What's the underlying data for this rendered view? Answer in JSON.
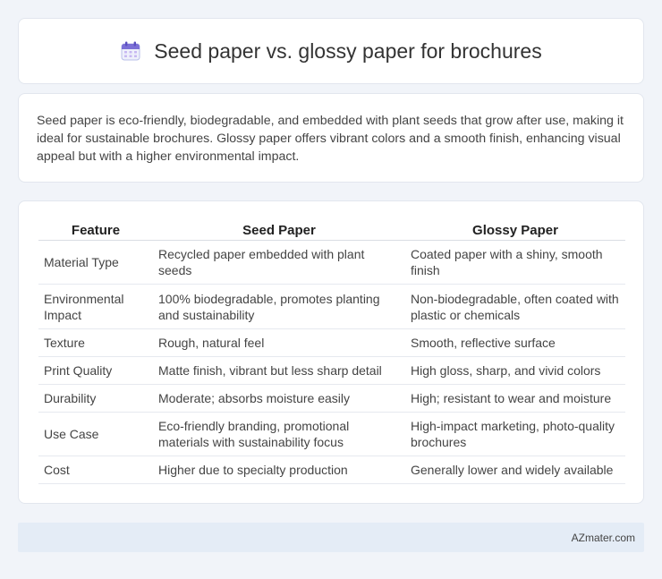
{
  "page": {
    "title": "Seed paper vs. glossy paper for brochures",
    "intro": "Seed paper is eco-friendly, biodegradable, and embedded with plant seeds that grow after use, making it ideal for sustainable brochures. Glossy paper offers vibrant colors and a smooth finish, enhancing visual appeal but with a higher environmental impact.",
    "icon": "calendar-icon"
  },
  "table": {
    "headers": [
      "Feature",
      "Seed Paper",
      "Glossy Paper"
    ],
    "rows": [
      [
        "Material Type",
        "Recycled paper embedded with plant seeds",
        "Coated paper with a shiny, smooth finish"
      ],
      [
        "Environmental Impact",
        "100% biodegradable, promotes planting and sustainability",
        "Non-biodegradable, often coated with plastic or chemicals"
      ],
      [
        "Texture",
        "Rough, natural feel",
        "Smooth, reflective surface"
      ],
      [
        "Print Quality",
        "Matte finish, vibrant but less sharp detail",
        "High gloss, sharp, and vivid colors"
      ],
      [
        "Durability",
        "Moderate; absorbs moisture easily",
        "High; resistant to wear and moisture"
      ],
      [
        "Use Case",
        "Eco-friendly branding, promotional materials with sustainability focus",
        "High-impact marketing, photo-quality brochures"
      ],
      [
        "Cost",
        "Higher due to specialty production",
        "Generally lower and widely available"
      ]
    ]
  },
  "footer": {
    "brand": "AZmater.com"
  },
  "colors": {
    "background": "#f1f4f9",
    "card": "#ffffff",
    "footer": "#e4ecf6",
    "icon_accent": "#7b6fd6"
  }
}
